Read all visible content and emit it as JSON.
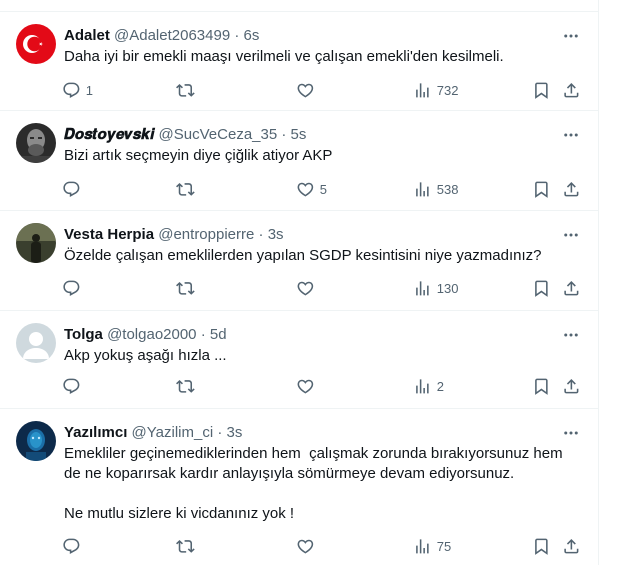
{
  "tweets": [
    {
      "name": "Adalet",
      "handle": "@Adalet2063499",
      "time": "6s",
      "text": "Daha iyi bir emekli maaşı verilmeli ve çalışan emekli'den kesilmeli.",
      "reply_count": "1",
      "retweet_count": "",
      "like_count": "",
      "view_count": "732",
      "avatar_colors": [
        "#e30a17",
        "#ffffff"
      ]
    },
    {
      "name": "𝑫𝒐𝒔𝒕𝒐𝒚𝒆𝒗𝒔𝒌𝒊",
      "handle": "@SucVeCeza_35",
      "time": "5s",
      "text": "Bizi artık seçmeyin diye çiğlik atiyor AKP",
      "reply_count": "",
      "retweet_count": "",
      "like_count": "5",
      "view_count": "538",
      "avatar_colors": [
        "#2b2b2b",
        "#8a8a8a"
      ]
    },
    {
      "name": "Vesta Herpia",
      "handle": "@entroppierre",
      "time": "3s",
      "text": "Özelde çalışan emeklilerden yapılan SGDP kesintisini niye yazmadınız?",
      "reply_count": "",
      "retweet_count": "",
      "like_count": "",
      "view_count": "130",
      "avatar_colors": [
        "#3a3f2e",
        "#9aa07a"
      ]
    },
    {
      "name": "Tolga",
      "handle": "@tolgao2000",
      "time": "5d",
      "text": "Akp yokuş aşağı hızla ...",
      "reply_count": "",
      "retweet_count": "",
      "like_count": "",
      "view_count": "2",
      "avatar_colors": [
        "#cfd9de",
        "#ffffff"
      ]
    },
    {
      "name": "Yazılımcı",
      "handle": "@Yazilim_ci",
      "time": "3s",
      "text": "Emekliler geçinemediklerinden hem  çalışmak zorunda bırakıyorsunuz hem de ne koparırsak kardır anlayışıyla sömürmeye devam ediyorsunuz.\n\nNe mutlu sizlere ki vicdanınız yok !",
      "reply_count": "",
      "retweet_count": "",
      "like_count": "",
      "view_count": "75",
      "avatar_colors": [
        "#0d2a4a",
        "#2fa3d9"
      ]
    }
  ],
  "separator": "·",
  "icons": {
    "more": "more-dots-icon",
    "reply": "reply-icon",
    "retweet": "retweet-icon",
    "like": "heart-icon",
    "views": "views-chart-icon",
    "bookmark": "bookmark-icon",
    "share": "share-icon"
  }
}
